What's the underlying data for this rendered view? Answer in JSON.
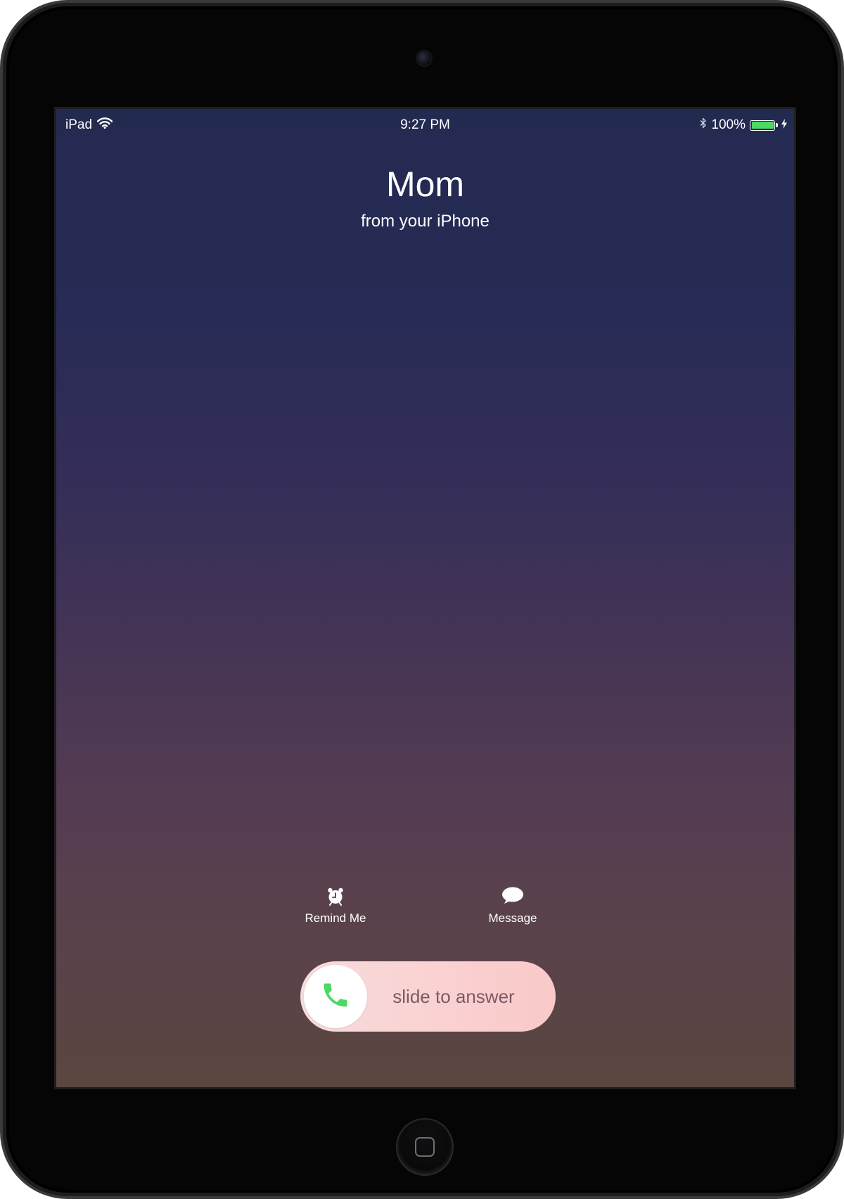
{
  "status_bar": {
    "device_label": "iPad",
    "time": "9:27 PM",
    "battery_percent": "100%",
    "battery_level": 1.0,
    "battery_color": "#4cd964",
    "icons": [
      "wifi-icon",
      "bluetooth-icon",
      "battery-icon",
      "charging-bolt-icon"
    ]
  },
  "caller": {
    "name": "Mom",
    "subtitle": "from your iPhone"
  },
  "actions": {
    "remind": {
      "label": "Remind Me",
      "icon": "alarm-clock-icon"
    },
    "message": {
      "label": "Message",
      "icon": "speech-bubble-icon"
    }
  },
  "slider": {
    "label": "slide to answer",
    "icon": "phone-icon",
    "icon_color": "#4cd964"
  },
  "colors": {
    "background_top": "#232a50",
    "background_bottom": "#5b4640",
    "slider_track": "#fbd0d0",
    "accent_green": "#4cd964"
  }
}
